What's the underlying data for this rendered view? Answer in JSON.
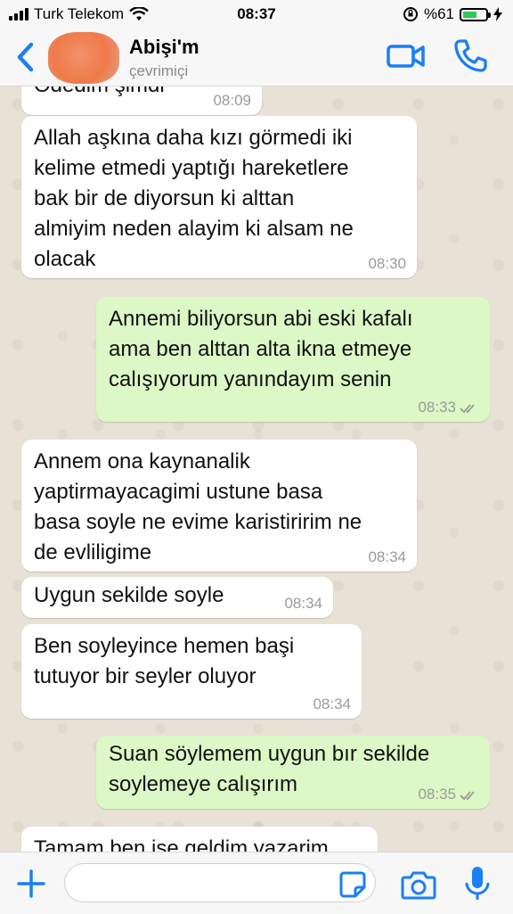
{
  "status_bar": {
    "carrier": "Turk Telekom",
    "time": "08:37",
    "battery": "%61",
    "battery_level": 0.61
  },
  "header": {
    "contact_name": "Abişi'm",
    "contact_status": "çevrimiçi"
  },
  "messages": [
    {
      "direction": "in",
      "text": "Ödedim şimdi",
      "time": "08:09"
    },
    {
      "direction": "in",
      "text": "Allah aşkına daha kızı görmedi iki\nkelime etmedi yaptığı hareketlere\nbak bir de diyorsun ki alttan\nalmiyim neden alayim ki alsam ne\nolacak",
      "time": "08:30"
    },
    {
      "direction": "out",
      "text": "Annemi biliyorsun abi eski kafalı\nama ben alttan alta ikna etmeye\ncalışıyorum yanındayım senin",
      "time": "08:33"
    },
    {
      "direction": "in",
      "text": "Annem ona kaynanalik\nyaptirmayacagimi ustune basa\nbasa soyle ne evime karistiririm ne\nde evliligime",
      "time": "08:34"
    },
    {
      "direction": "in",
      "text": "Uygun sekilde soyle",
      "time": "08:34"
    },
    {
      "direction": "in",
      "text": "Ben soyleyince hemen başi\ntutuyor bir seyler oluyor",
      "time": "08:34"
    },
    {
      "direction": "out",
      "text": "Suan söylemem uygun bır sekilde\nsoylemeye calışırım",
      "time": "08:35"
    },
    {
      "direction": "in",
      "text": "Tamam ben ise geldim yazarim",
      "time": ""
    }
  ],
  "colors": {
    "accent": "#1a7ff2",
    "incoming_bubble": "#ffffff",
    "outgoing_bubble": "#dcf8c6",
    "chat_background": "#e8e1d6"
  },
  "icons": {
    "back": "chevron-left-icon",
    "video": "video-camera-icon",
    "call": "phone-icon",
    "plus": "plus-icon",
    "sticker": "sticker-icon",
    "camera": "camera-icon",
    "mic": "microphone-icon"
  }
}
